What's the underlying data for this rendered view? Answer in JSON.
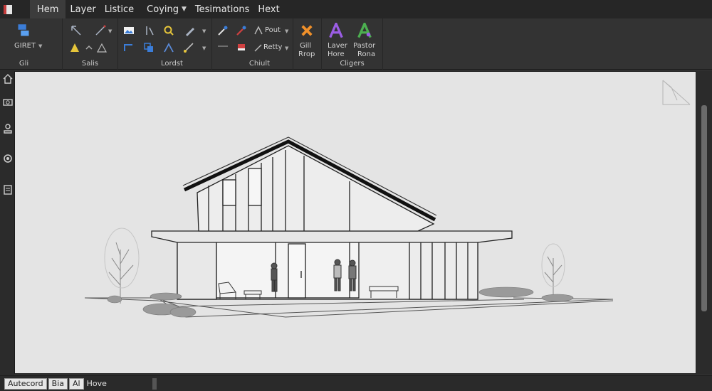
{
  "menu": {
    "tabs": [
      "Hem",
      "Layer",
      "Listice",
      "Coying",
      "Tesimations",
      "Hext"
    ],
    "active_index": 0
  },
  "ribbon": {
    "groups": [
      {
        "label": "Gli",
        "button": "GIRET"
      },
      {
        "label": "Salis"
      },
      {
        "label": "Lordst"
      },
      {
        "label": "Chiult",
        "items": [
          "Pout",
          "Retty"
        ]
      },
      {
        "label": "",
        "button_lines": [
          "Gill",
          "Rrop"
        ]
      },
      {
        "label": "Cligers",
        "buttons": [
          {
            "lines": [
              "Laver",
              "Hore"
            ]
          },
          {
            "lines": [
              "Pastor",
              "Rona"
            ]
          }
        ]
      }
    ]
  },
  "statusbar": {
    "items": [
      "Autecord",
      "Bia",
      "Al",
      "Hove"
    ]
  },
  "icons": {
    "accent_blue": "#3b7dd8",
    "accent_orange": "#f0902a",
    "accent_purple": "#9b5de5",
    "accent_green": "#4caf50",
    "accent_yellow": "#e6c53a",
    "accent_red": "#d04040"
  }
}
